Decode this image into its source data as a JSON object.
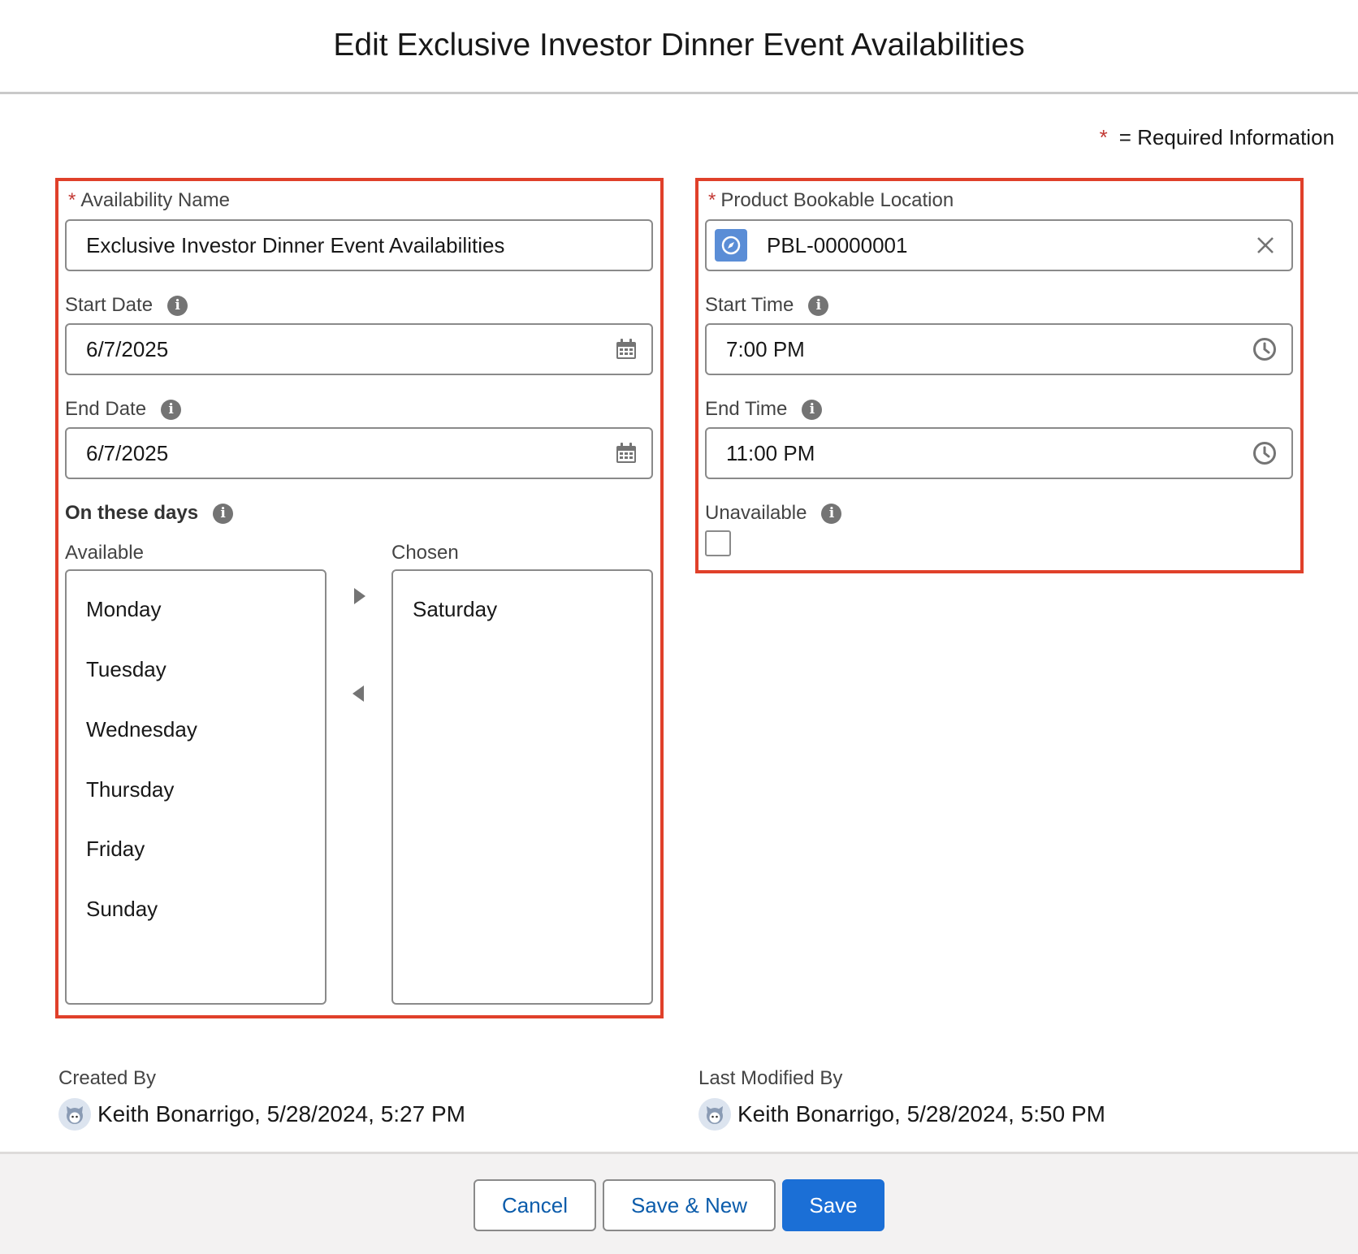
{
  "modal": {
    "title": "Edit Exclusive Investor Dinner Event Availabilities",
    "required_note_star": "*",
    "required_note": "= Required Information"
  },
  "left": {
    "availability_name": {
      "star": "*",
      "label": "Availability Name",
      "value": "Exclusive Investor Dinner Event Availabilities"
    },
    "start_date": {
      "label": "Start Date",
      "value": "6/7/2025"
    },
    "end_date": {
      "label": "End Date",
      "value": "6/7/2025"
    },
    "days": {
      "label": "On these days",
      "available_label": "Available",
      "chosen_label": "Chosen",
      "available": [
        "Monday",
        "Tuesday",
        "Wednesday",
        "Thursday",
        "Friday",
        "Sunday"
      ],
      "chosen": [
        "Saturday"
      ]
    }
  },
  "right": {
    "location": {
      "star": "*",
      "label": "Product Bookable Location",
      "value": "PBL-00000001"
    },
    "start_time": {
      "label": "Start Time",
      "value": "7:00 PM"
    },
    "end_time": {
      "label": "End Time",
      "value": "11:00 PM"
    },
    "unavailable": {
      "label": "Unavailable",
      "checked": false
    }
  },
  "meta": {
    "created_label": "Created By",
    "created_value": "Keith Bonarrigo, 5/28/2024, 5:27 PM",
    "modified_label": "Last Modified By",
    "modified_value": "Keith Bonarrigo, 5/28/2024, 5:50 PM"
  },
  "footer": {
    "cancel": "Cancel",
    "save_new": "Save & New",
    "save": "Save"
  },
  "colors": {
    "highlight": "#e0402a",
    "brand": "#1b6fd6",
    "required": "#c23934"
  }
}
